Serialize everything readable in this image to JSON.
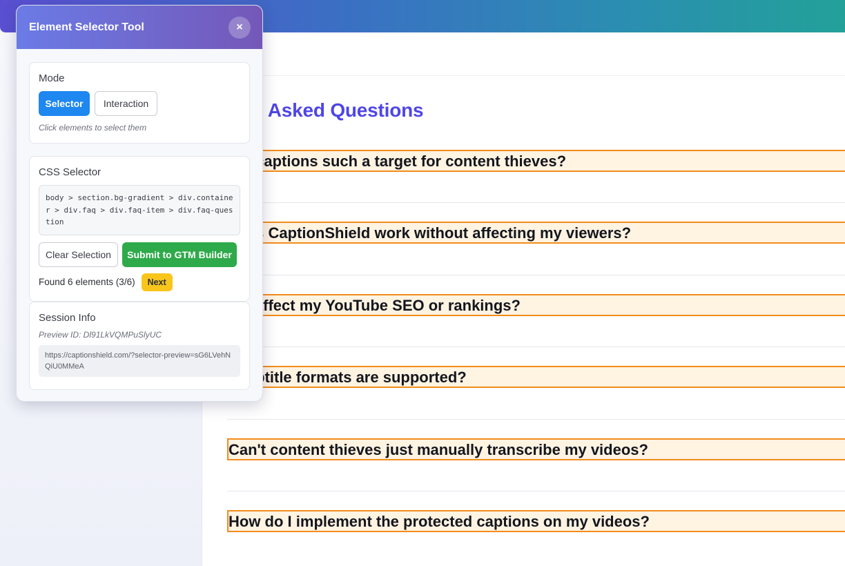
{
  "page": {
    "faq_title": "quently Asked Questions",
    "questions": [
      "are captions such a target for content thieves?",
      "does CaptionShield work without affecting my viewers?",
      "his affect my YouTube SEO or rankings?",
      "t subtitle formats are supported?",
      "Can't content thieves just manually transcribe my videos?",
      "How do I implement the protected captions on my videos?"
    ]
  },
  "tool": {
    "title": "Element Selector Tool",
    "close_glyph": "×",
    "mode": {
      "heading": "Mode",
      "selector_label": "Selector",
      "interaction_label": "Interaction",
      "hint": "Click elements to select them",
      "active": "Selector"
    },
    "css": {
      "heading": "CSS Selector",
      "selector_value": "body > section.bg-gradient > div.container > div.faq > div.faq-item > div.faq-question",
      "clear_label": "Clear Selection",
      "submit_label": "Submit to GTM Builder",
      "found_text": "Found 6 elements (3/6)",
      "next_label": "Next"
    },
    "session": {
      "heading": "Session Info",
      "preview_id": "Preview ID: Dl91LkVQMPuSlyUC",
      "url": "https://captionshield.com/?selector-preview=sG6LVehNQiU0MMeA"
    }
  },
  "colors": {
    "accent": "#4f46e5",
    "highlight_border": "#f28c1b",
    "highlight_fill": "#fff3e2",
    "primary_button": "#1e87f0",
    "success_button": "#2eaa4a",
    "next_badge": "#f8c51c"
  }
}
